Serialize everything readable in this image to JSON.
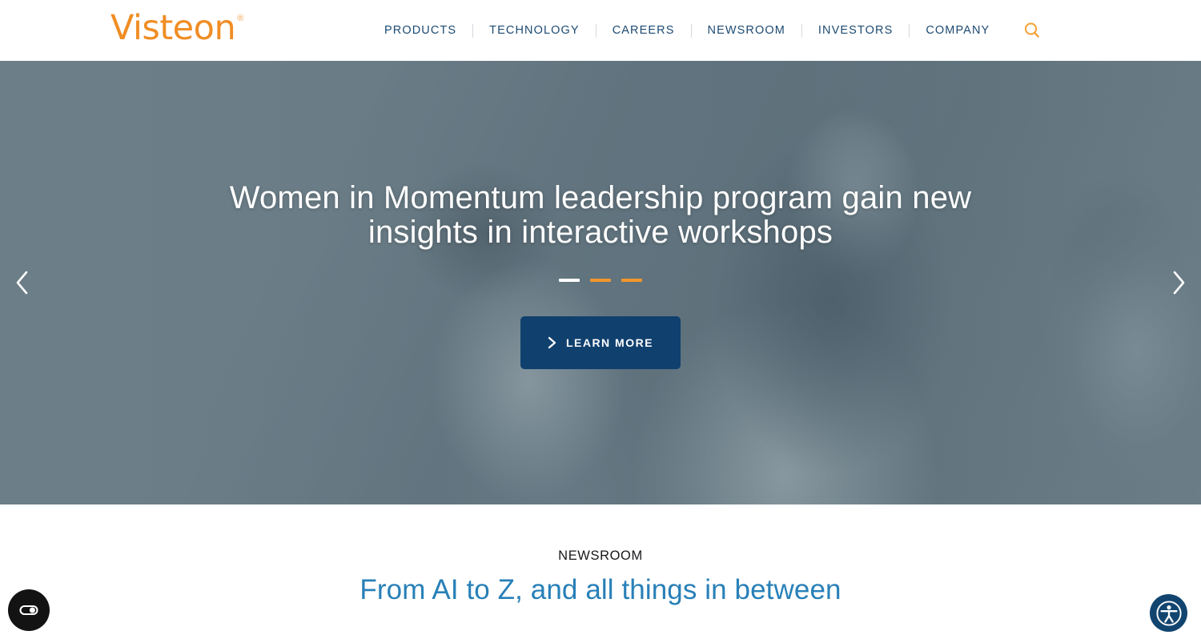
{
  "header": {
    "logo": {
      "text": "Visteon",
      "registered": "®"
    },
    "nav_items": [
      {
        "label": "PRODUCTS"
      },
      {
        "label": "TECHNOLOGY"
      },
      {
        "label": "CAREERS"
      },
      {
        "label": "NEWSROOM"
      },
      {
        "label": "INVESTORS"
      },
      {
        "label": "COMPANY"
      }
    ],
    "search_icon": "search-icon"
  },
  "hero": {
    "title": "Women in Momentum leadership program gain new insights in interactive workshops",
    "cta_label": "LEARN MORE",
    "cta_icon": "chevron-right-icon",
    "prev_icon": "chevron-left-icon",
    "next_icon": "chevron-right-icon",
    "slides": [
      {
        "state": "active"
      },
      {
        "state": "idle"
      },
      {
        "state": "idle"
      }
    ]
  },
  "newsroom": {
    "eyebrow": "NEWSROOM",
    "title": "From AI to Z, and all things in between"
  },
  "widgets": {
    "cookie_icon": "cookie-consent-icon",
    "accessibility_icon": "accessibility-icon"
  },
  "colors": {
    "brand_orange": "#f08d24",
    "nav_navy": "#1d4a72",
    "button_navy": "#10406e",
    "newsroom_blue": "#2880b8",
    "hero_overlay": "#6d7f88"
  }
}
